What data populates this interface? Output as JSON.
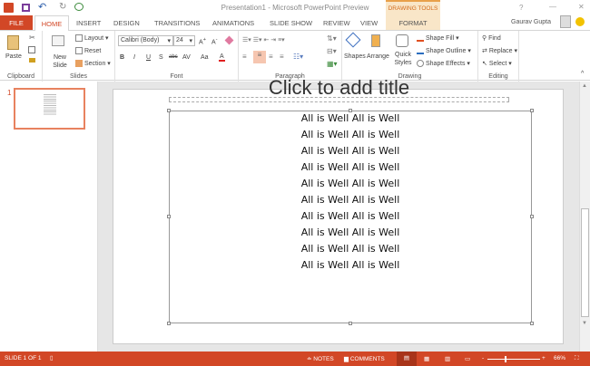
{
  "window": {
    "title": "Presentation1 - Microsoft PowerPoint Preview",
    "user": "Gaurav Gupta",
    "help": "?"
  },
  "tabs": [
    "FILE",
    "HOME",
    "INSERT",
    "DESIGN",
    "TRANSITIONS",
    "ANIMATIONS",
    "SLIDE SHOW",
    "REVIEW",
    "VIEW",
    "FORMAT"
  ],
  "contextual_tab": "DRAWING TOOLS",
  "ribbon": {
    "clipboard": {
      "label": "Clipboard",
      "paste": "Paste"
    },
    "slides": {
      "label": "Slides",
      "new_slide": "New Slide",
      "layout": "Layout",
      "reset": "Reset",
      "section": "Section"
    },
    "font": {
      "label": "Font",
      "font_name": "Calibri (Body)",
      "font_size": "24",
      "bold": "B",
      "italic": "I",
      "underline": "U",
      "shadow": "S",
      "strike": "abc",
      "spacing": "AV",
      "case": "Aa",
      "color": "A"
    },
    "paragraph": {
      "label": "Paragraph"
    },
    "drawing": {
      "label": "Drawing",
      "shapes": "Shapes",
      "arrange": "Arrange",
      "quick_styles": "Quick Styles",
      "shape_fill": "Shape Fill",
      "shape_outline": "Shape Outline",
      "shape_effects": "Shape Effects"
    },
    "editing": {
      "label": "Editing",
      "find": "Find",
      "replace": "Replace",
      "select": "Select"
    }
  },
  "thumbnail": {
    "number": "1"
  },
  "slide": {
    "title_placeholder": "Click to add title",
    "lines": [
      "All is Well All is Well",
      "All is Well All is Well",
      "All is Well All is Well",
      "All is Well All is Well",
      "All is Well All is Well",
      "All is Well All is Well",
      "All is Well All is Well",
      "All is Well All is Well",
      "All is Well All is Well",
      "All is Well All is Well"
    ]
  },
  "status": {
    "slide": "SLIDE 1 OF 1",
    "notes": "NOTES",
    "comments": "COMMENTS",
    "zoom": "66%",
    "zoom_fraction": 0.33
  },
  "colors": {
    "accent": "#d24726",
    "format_tab": "#f9e6c8"
  }
}
